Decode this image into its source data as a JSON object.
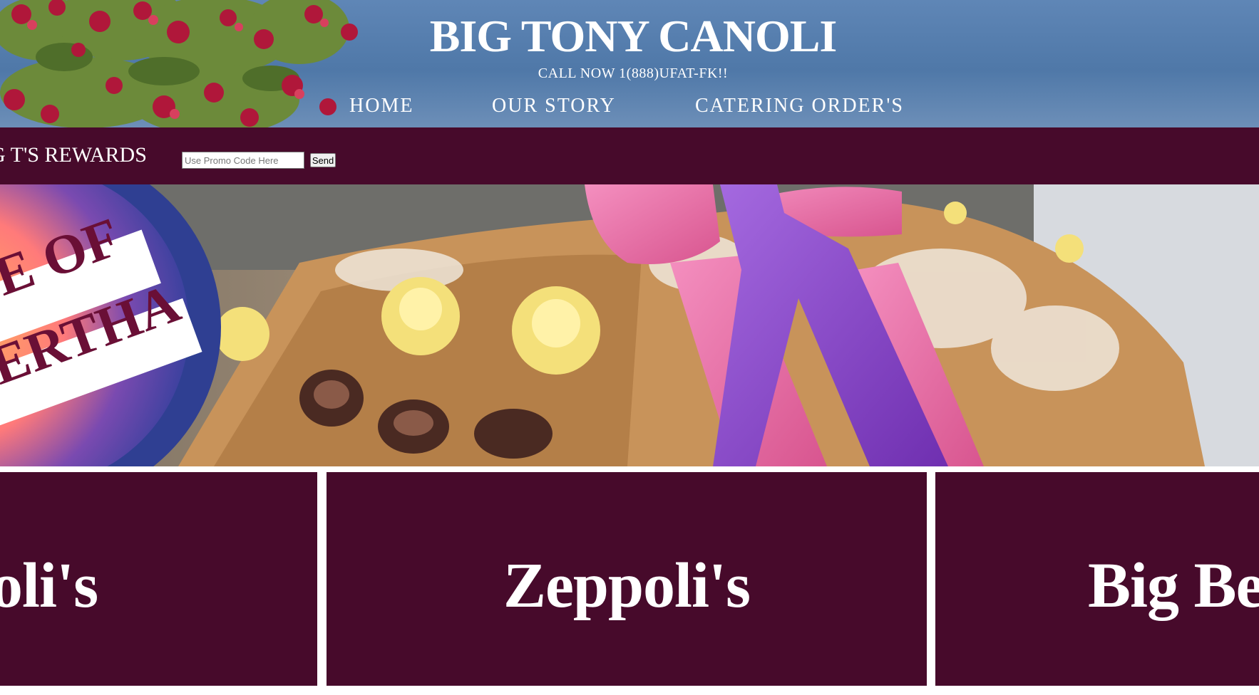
{
  "header": {
    "title": "BIG TONY CANOLI",
    "phone": "CALL NOW 1(888)UFAT-FK!!",
    "nav": [
      {
        "label": "HOME"
      },
      {
        "label": "OUR STORY"
      },
      {
        "label": "CATERING ORDER'S"
      }
    ]
  },
  "promo_bar": {
    "rewards_label": "G T'S REWARDS",
    "promo_placeholder": "Use Promo Code Here",
    "send_label": "Send"
  },
  "hero": {
    "badge_line_1": "E OF",
    "badge_line_2": "ERTHA"
  },
  "cards": [
    {
      "title": "noli's"
    },
    {
      "title": "Zeppoli's"
    },
    {
      "title": "Big Be"
    }
  ],
  "colors": {
    "brand_maroon": "#470a2b",
    "sky_blue": "#5f86b6",
    "ribbon_pink": "#e46aa8",
    "ribbon_purple": "#8a46c8"
  }
}
